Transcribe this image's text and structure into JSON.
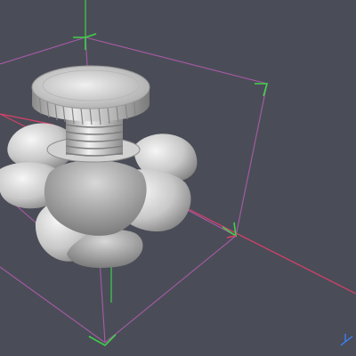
{
  "viewport": {
    "background": "#4a4d57",
    "scene": "3d-model-preview",
    "model": "knurled-thumb-screw-with-lobed-knob"
  },
  "bounding_box": {
    "edge_color": "#a95aa8",
    "x_axis_color": "#d9406a",
    "y_axis_color": "#3fd04a",
    "z_axis_color": "#4aa3ff"
  },
  "axis_indicator": {
    "icon": "axis-triad-icon",
    "color": "#3b82ff"
  },
  "model_colors": {
    "base": "#c9c9c9",
    "highlight": "#f2f2f2",
    "shadow": "#7c7c7c"
  }
}
